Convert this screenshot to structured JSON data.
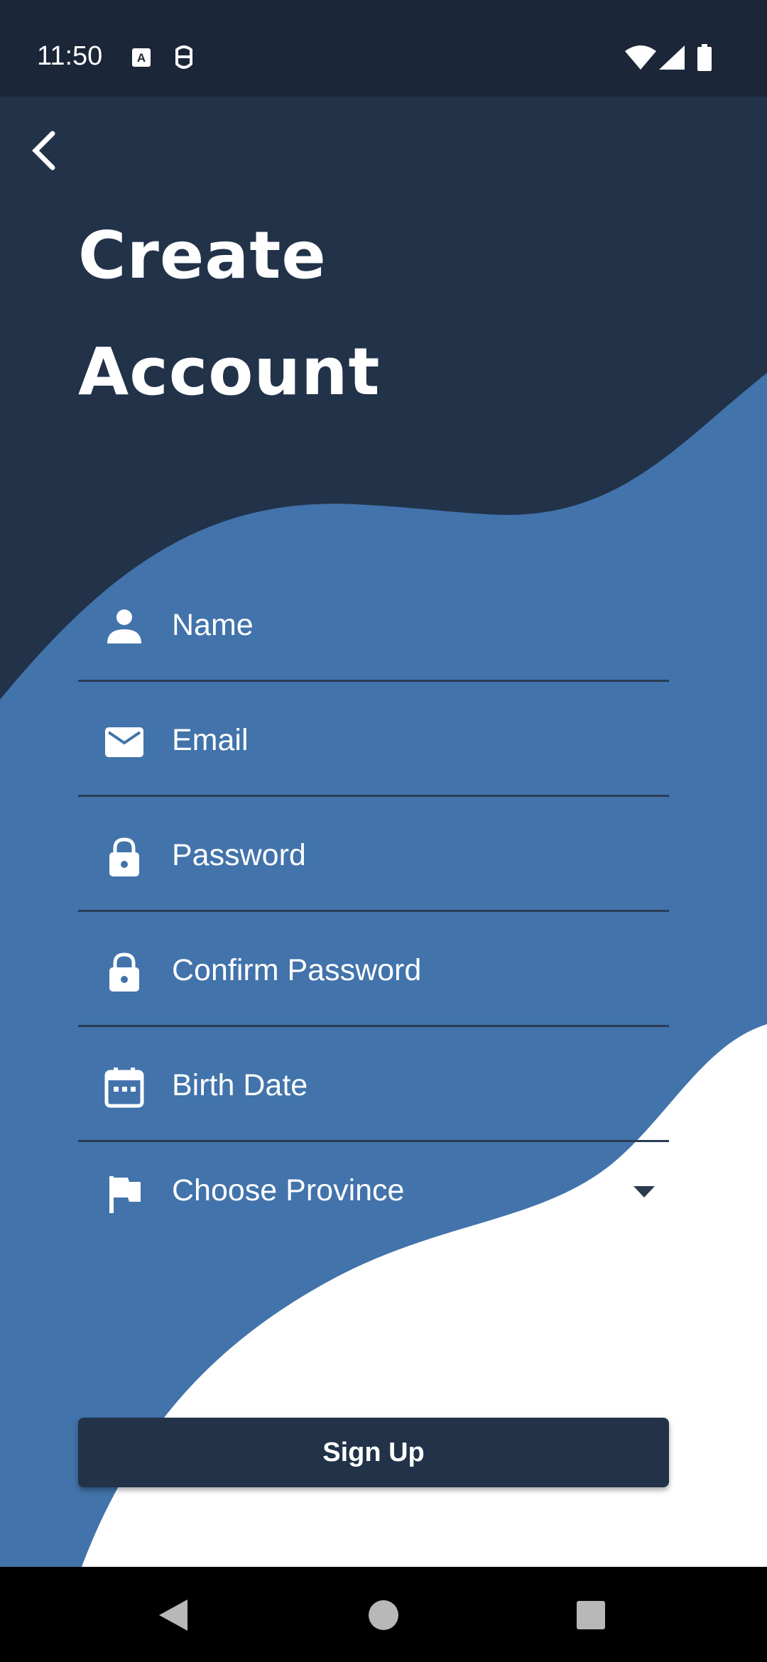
{
  "status_bar": {
    "time": "11:50",
    "icons": [
      "a-keyboard-icon",
      "robot-icon",
      "wifi-icon",
      "signal-icon",
      "battery-icon"
    ]
  },
  "header": {
    "back_icon": "chevron-left-icon",
    "title_line1": "Create",
    "title_line2": "Account"
  },
  "form": {
    "name": {
      "placeholder": "Name",
      "icon": "person-icon"
    },
    "email": {
      "placeholder": "Email",
      "icon": "mail-icon"
    },
    "password": {
      "placeholder": "Password",
      "icon": "lock-icon"
    },
    "confirm_password": {
      "placeholder": "Confirm Password",
      "icon": "lock-icon"
    },
    "birth_date": {
      "placeholder": "Birth Date",
      "icon": "calendar-icon"
    },
    "province": {
      "selected": "Choose Province",
      "icon": "flag-icon"
    }
  },
  "signup_button": {
    "label": "Sign Up"
  },
  "nav_bar": {
    "icons": [
      "back-triangle-icon",
      "home-circle-icon",
      "recents-square-icon"
    ]
  },
  "colors": {
    "dark_navy": "#213249",
    "status_bar": "#1b2638",
    "wave_blue": "#4273ab",
    "white": "#ffffff"
  }
}
